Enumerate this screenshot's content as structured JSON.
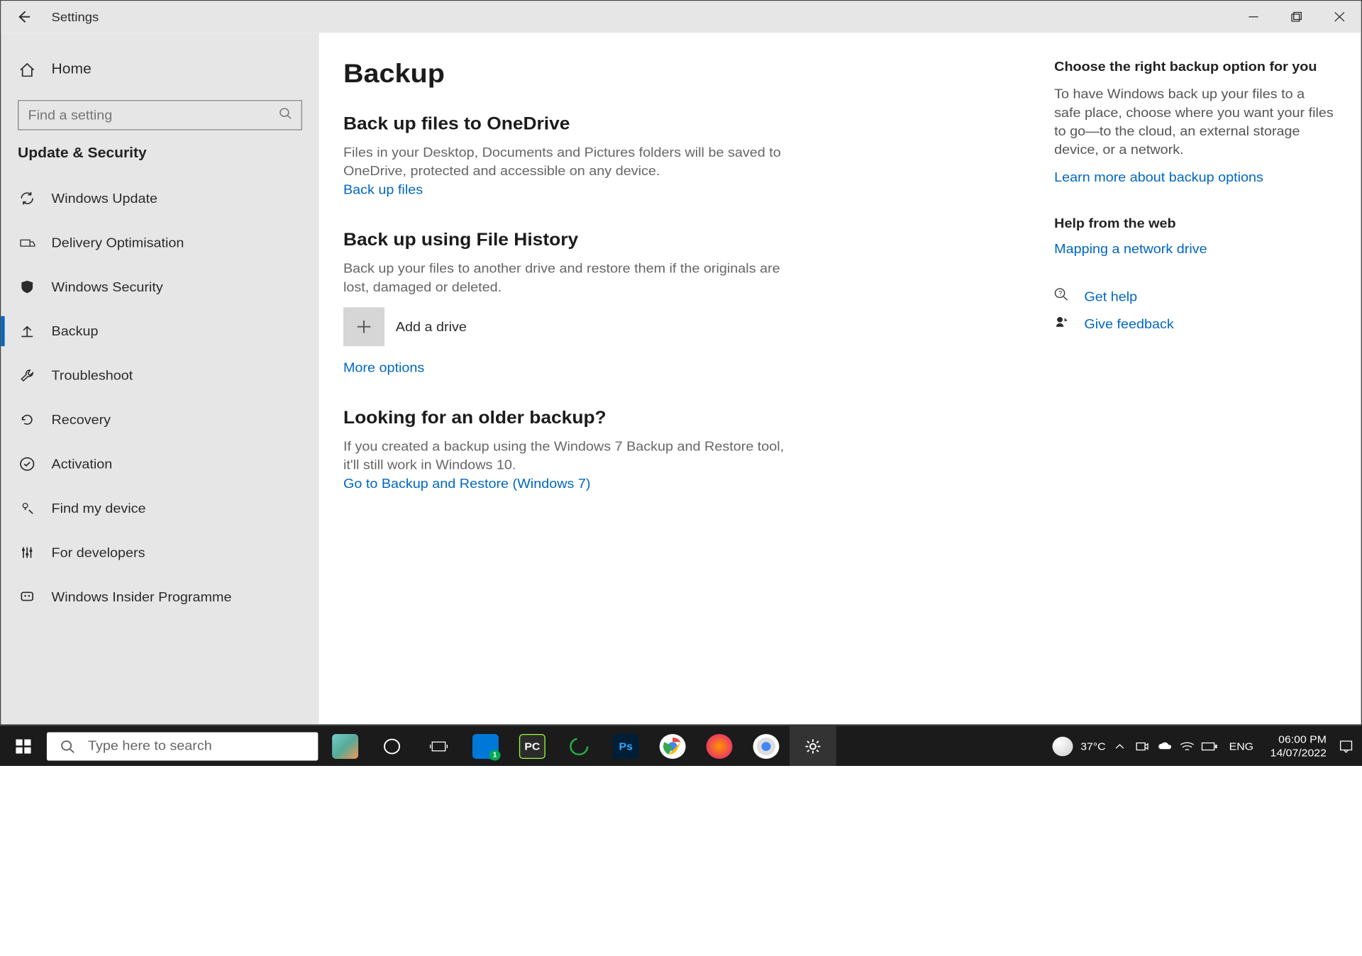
{
  "titlebar": {
    "title": "Settings"
  },
  "sidebar": {
    "home": "Home",
    "search_placeholder": "Find a setting",
    "category": "Update & Security",
    "items": [
      {
        "label": "Windows Update"
      },
      {
        "label": "Delivery Optimisation"
      },
      {
        "label": "Windows Security"
      },
      {
        "label": "Backup",
        "active": true
      },
      {
        "label": "Troubleshoot"
      },
      {
        "label": "Recovery"
      },
      {
        "label": "Activation"
      },
      {
        "label": "Find my device"
      },
      {
        "label": "For developers"
      },
      {
        "label": "Windows Insider Programme"
      }
    ]
  },
  "page": {
    "title": "Backup",
    "onedrive": {
      "head": "Back up files to OneDrive",
      "body": "Files in your Desktop, Documents and Pictures folders will be saved to OneDrive, protected and accessible on any device.",
      "link": "Back up files"
    },
    "filehistory": {
      "head": "Back up using File History",
      "body": "Back up your files to another drive and restore them if the originals are lost, damaged or deleted.",
      "add": "Add a drive",
      "more": "More options"
    },
    "older": {
      "head": "Looking for an older backup?",
      "body": "If you created a backup using the Windows 7 Backup and Restore tool, it'll still work in Windows 10.",
      "link": "Go to Backup and Restore (Windows 7)"
    }
  },
  "aside": {
    "choose": {
      "head": "Choose the right backup option for you",
      "body": "To have Windows back up your files to a safe place, choose where you want your files to go—to the cloud, an external storage device, or a network.",
      "link": "Learn more about backup options"
    },
    "help": {
      "head": "Help from the web",
      "link": "Mapping a network drive"
    },
    "gethelp": "Get help",
    "feedback": "Give feedback"
  },
  "taskbar": {
    "search_placeholder": "Type here to search",
    "weather_temp": "37°C",
    "lang": "ENG",
    "time": "06:00 PM",
    "date": "14/07/2022"
  }
}
